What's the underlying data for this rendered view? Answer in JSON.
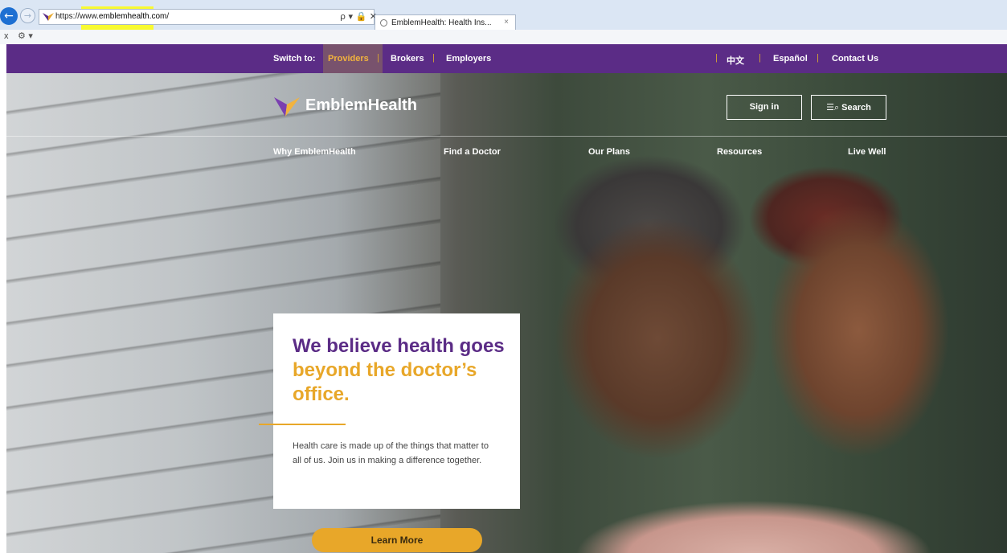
{
  "browser": {
    "url_prefix": "https://www.",
    "url_host": "emblemhealth.com",
    "url_suffix": "/",
    "address_tools": "ρ ▾ 🔒 ✕",
    "tab_title": "EmblemHealth: Health Ins...",
    "tab_close": "×",
    "favbar_close": "x",
    "favbar_gear": "⚙ ▾",
    "back_icon": "←",
    "forward_icon": "→"
  },
  "utility": {
    "switch_label": "Switch to:",
    "providers": "Providers",
    "brokers": "Brokers",
    "employers": "Employers",
    "chinese": "中文",
    "spanish": "Español",
    "contact": "Contact Us",
    "separator": "|"
  },
  "header": {
    "logo_text": "EmblemHealth",
    "sign_in": "Sign in",
    "search_icon": "☰⌕",
    "search": "Search"
  },
  "nav": {
    "items": [
      "Why EmblemHealth",
      "Find a Doctor",
      "Our Plans",
      "Resources",
      "Live Well"
    ]
  },
  "hero_card": {
    "headline_part1": "We believe health goes ",
    "headline_accent": "beyond the doctor’s office.",
    "body": "Health care is made up of the things that matter to all of us. Join us in making a difference together.",
    "cta": "Learn More"
  },
  "colors": {
    "brand_purple": "#5b2c86",
    "brand_gold": "#e8a729"
  }
}
